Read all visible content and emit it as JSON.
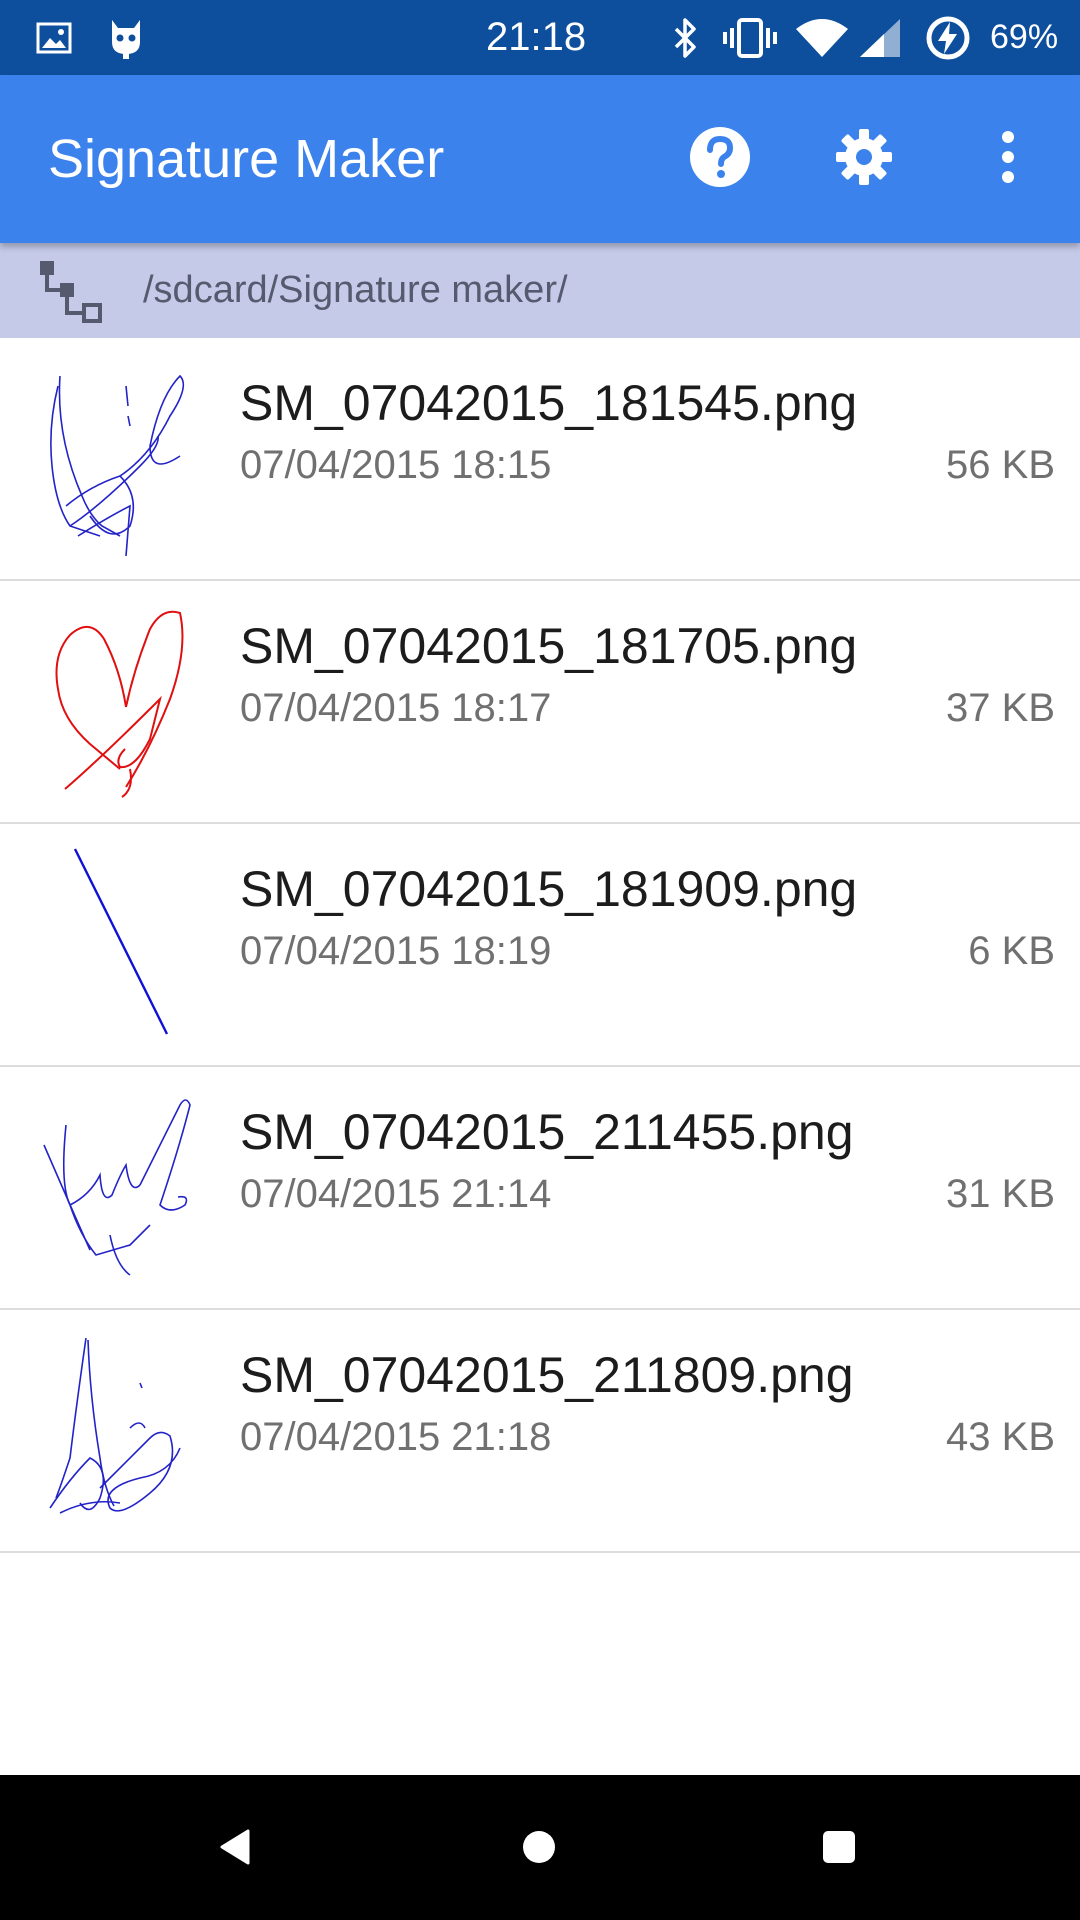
{
  "status_bar": {
    "time": "21:18",
    "battery_percent": "69%",
    "icons": [
      "gallery-icon",
      "cyanogen-icon",
      "bluetooth-icon",
      "vibrate-icon",
      "wifi-icon",
      "signal-icon",
      "battery-charging-icon"
    ],
    "background_color": "#0d4f9c"
  },
  "app_bar": {
    "title": "Signature Maker",
    "actions": [
      "help-icon",
      "settings-icon",
      "overflow-menu-icon"
    ],
    "background_color": "#3b82ec"
  },
  "path_bar": {
    "path": "/sdcard/Signature maker/",
    "icon": "folder-tree-icon",
    "background_color": "#c5cae9"
  },
  "files": [
    {
      "name": "SM_07042015_181545.png",
      "date": "07/04/2015 18:15",
      "size": "56 KB",
      "stroke_color": "#2323c8"
    },
    {
      "name": "SM_07042015_181705.png",
      "date": "07/04/2015 18:17",
      "size": "37 KB",
      "stroke_color": "#e01010"
    },
    {
      "name": "SM_07042015_181909.png",
      "date": "07/04/2015 18:19",
      "size": "6 KB",
      "stroke_color": "#1010d8"
    },
    {
      "name": "SM_07042015_211455.png",
      "date": "07/04/2015 21:14",
      "size": "31 KB",
      "stroke_color": "#2323c8"
    },
    {
      "name": "SM_07042015_211809.png",
      "date": "07/04/2015 21:18",
      "size": "43 KB",
      "stroke_color": "#2323c8"
    }
  ],
  "nav_bar": {
    "buttons": [
      "back-icon",
      "home-icon",
      "recents-icon"
    ]
  }
}
